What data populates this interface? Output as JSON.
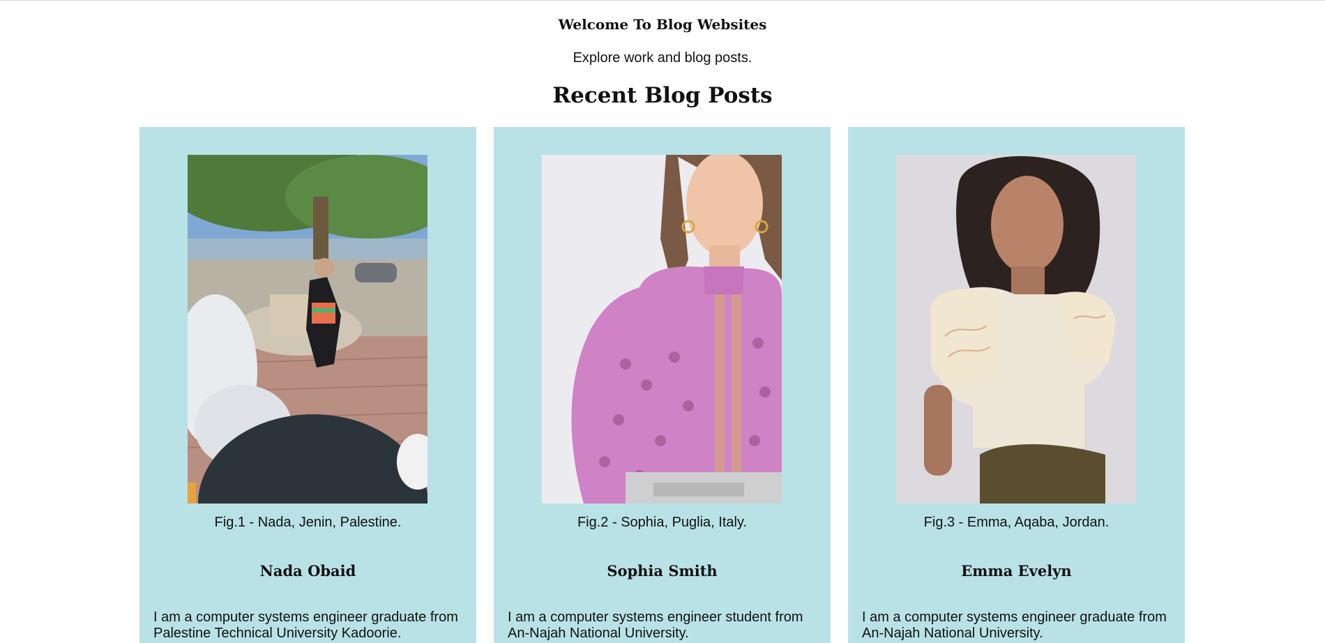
{
  "header": {
    "site_title": "Welcome To Blog Websites",
    "tagline": "Explore work and blog posts.",
    "section_title": "Recent Blog Posts"
  },
  "posts": [
    {
      "caption": "Fig.1 - Nada, Jenin, Palestine.",
      "author": "Nada Obaid",
      "bio": "I am a computer systems engineer graduate from Palestine Technical University Kadoorie.",
      "photo_description": "graduate-photo"
    },
    {
      "caption": "Fig.2 - Sophia, Puglia, Italy.",
      "author": "Sophia Smith",
      "bio": "I am a computer systems engineer student from An-Najah National University.",
      "photo_description": "portrait-photo"
    },
    {
      "caption": "Fig.3 - Emma, Aqaba, Jordan.",
      "author": "Emma Evelyn",
      "bio": "I am a computer systems engineer graduate from An-Najah National University.",
      "photo_description": "portrait-photo"
    }
  ],
  "colors": {
    "card_background": "#b9e2e7",
    "page_background": "#ffffff",
    "text": "#111111"
  }
}
